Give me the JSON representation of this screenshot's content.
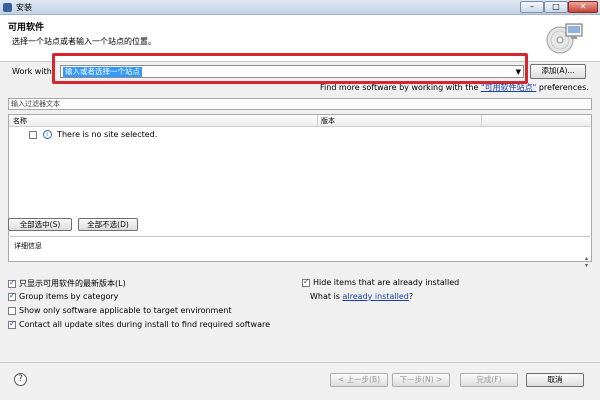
{
  "window": {
    "title": "安装"
  },
  "header": {
    "title": "可用软件",
    "description": "选择一个站点或者输入一个站点的位置。"
  },
  "work_with": {
    "label": "Work with",
    "placeholder": "输入或者选择一个站点",
    "add_button": "添加(A)..."
  },
  "find_more": {
    "prefix": "Find more software by working with the ",
    "link": "\"可用软件站点\"",
    "suffix": " preferences."
  },
  "filter": {
    "placeholder": "输入过滤器文本"
  },
  "table": {
    "columns": [
      "名称",
      "版本"
    ],
    "rows": [
      {
        "text": "There is no site selected.",
        "checked": false
      }
    ]
  },
  "selection_buttons": {
    "select_all": "全部选中(S)",
    "deselect_all": "全部不选(D)"
  },
  "details": {
    "label": "详细信息"
  },
  "options": {
    "show_latest": {
      "label": "只显示可用软件的最新版本(L)",
      "checked": true
    },
    "group_by_category": {
      "label": "Group items by category",
      "checked": true
    },
    "show_applicable": {
      "label": "Show only software applicable to target environment",
      "checked": false
    },
    "contact_sites": {
      "label": "Contact all update sites during install to find required software",
      "checked": true
    },
    "hide_installed": {
      "label": "Hide items that are already installed",
      "checked": true
    },
    "what_is": {
      "prefix": "What is ",
      "link": "already installed",
      "suffix": "?"
    }
  },
  "footer": {
    "prev": "< 上一步(B)",
    "next": "下一步(N) >",
    "finish": "完成(F)",
    "cancel": "取消"
  }
}
